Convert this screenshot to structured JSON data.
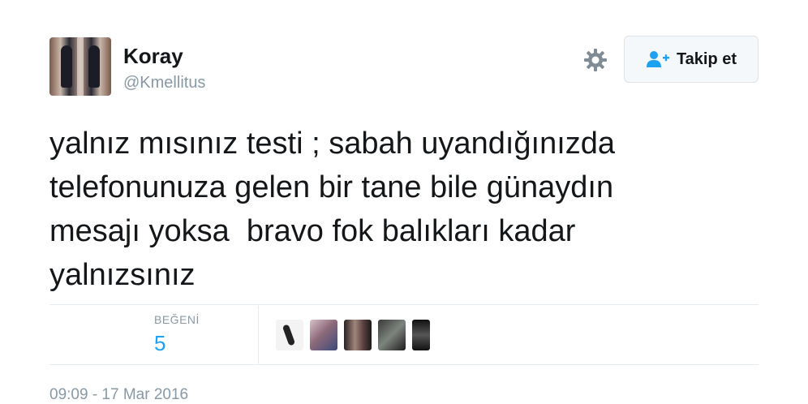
{
  "author": {
    "name": "Koray",
    "handle": "@Kmellitus"
  },
  "actions": {
    "follow_label": "Takip et"
  },
  "tweet": {
    "text": "yalnız mısınız testi ; sabah uyandığınızda\ntelefonunuza gelen bir tane bile günaydın\nmesajı yoksa  bravo fok balıkları kadar\nyalnızsınız"
  },
  "stats": {
    "likes_label": "BEĞENİ",
    "likes_count": "5"
  },
  "meta": {
    "timestamp": "09:09 - 17 Mar 2016"
  },
  "icons": {
    "settings": "gear-icon",
    "follow": "add-user-icon"
  },
  "colors": {
    "link_blue": "#1da1f2",
    "secondary_text": "#8899a6",
    "primary_text": "#14171a"
  }
}
